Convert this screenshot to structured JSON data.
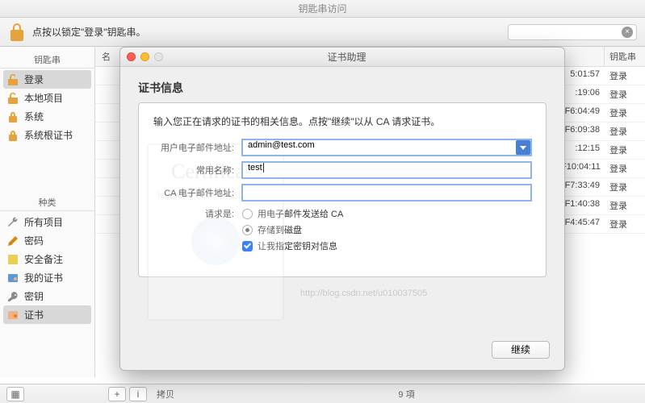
{
  "app_title": "钥匙串访问",
  "toolbar": {
    "lock_hint": "点按以锁定\"登录\"钥匙串。"
  },
  "search": {
    "placeholder": ""
  },
  "sidebar": {
    "keychains_header": "钥匙串",
    "keychains": [
      {
        "label": "登录",
        "selected": true
      },
      {
        "label": "本地项目"
      },
      {
        "label": "系统"
      },
      {
        "label": "系统根证书"
      }
    ],
    "categories_header": "种类",
    "categories": [
      {
        "label": "所有项目"
      },
      {
        "label": "密码"
      },
      {
        "label": "安全备注"
      },
      {
        "label": "我的证书"
      },
      {
        "label": "密钥"
      },
      {
        "label": "证书",
        "selected": true
      }
    ]
  },
  "table": {
    "col_name": "名",
    "col_chain": "钥匙串",
    "rows": [
      {
        "time": "5:01:57",
        "chain": "登录"
      },
      {
        "time": ":19:06",
        "chain": "登录"
      },
      {
        "time": "F6:04:49",
        "chain": "登录"
      },
      {
        "time": "F6:09:38",
        "chain": "登录"
      },
      {
        "time": ":12:15",
        "chain": "登录"
      },
      {
        "time": "F10:04:11",
        "chain": "登录"
      },
      {
        "time": "F7:33:49",
        "chain": "登录"
      },
      {
        "time": "F1:40:38",
        "chain": "登录"
      },
      {
        "time": "F4:45:47",
        "chain": "登录"
      }
    ]
  },
  "footer": {
    "copy_label": "拷贝",
    "count": "9 項"
  },
  "modal": {
    "title": "证书助理",
    "section_title": "证书信息",
    "intro": "输入您正在请求的证书的相关信息。点按\"继续\"以从 CA 请求证书。",
    "fields": {
      "email_label": "用户电子邮件地址:",
      "email_value": "admin@test.com",
      "common_name_label": "常用名称:",
      "common_name_value": "test",
      "ca_email_label": "CA 电子邮件地址:",
      "ca_email_value": "",
      "request_is_label": "请求是:",
      "opt_email_ca": "用电子邮件发送给 CA",
      "opt_save_disk": "存储到磁盘",
      "opt_key_pair": "让我指定密钥对信息"
    },
    "continue_label": "继续",
    "watermark": "http://blog.csdn.net/u010037505",
    "cert_word": "Certificate"
  }
}
